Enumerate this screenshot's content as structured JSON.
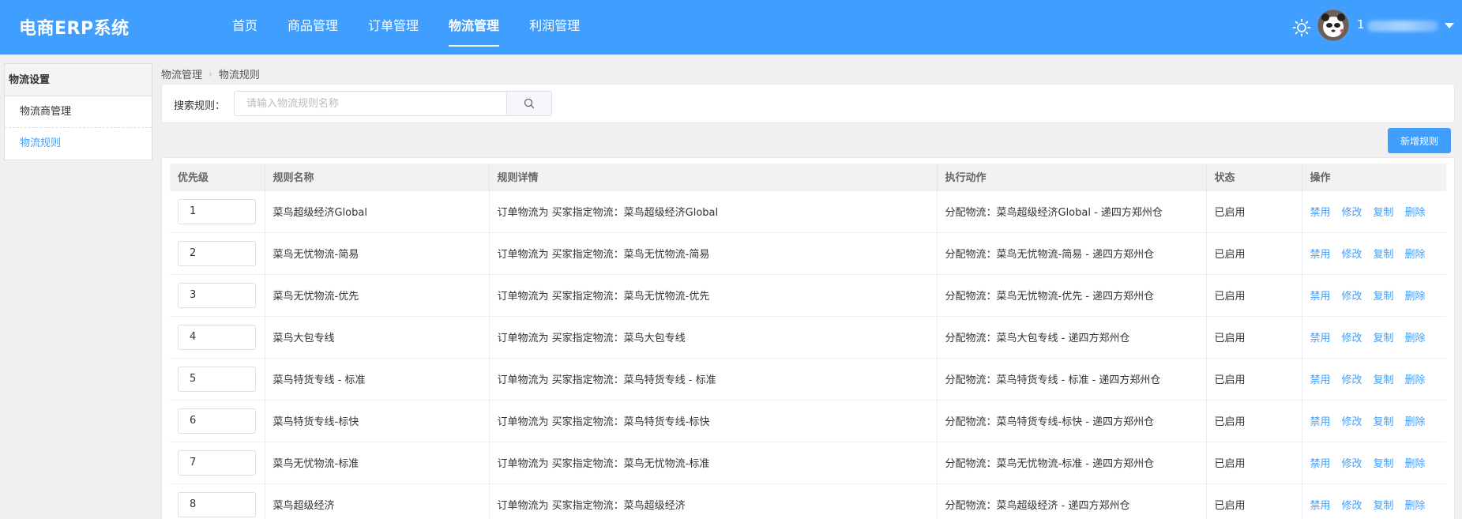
{
  "header": {
    "brand": "电商ERP系统",
    "nav": [
      {
        "label": "首页",
        "active": false
      },
      {
        "label": "商品管理",
        "active": false
      },
      {
        "label": "订单管理",
        "active": false
      },
      {
        "label": "物流管理",
        "active": true
      },
      {
        "label": "利润管理",
        "active": false
      }
    ],
    "user_initial": "1"
  },
  "sidebar": {
    "title": "物流设置",
    "items": [
      {
        "label": "物流商管理",
        "active": false
      },
      {
        "label": "物流规则",
        "active": true
      }
    ]
  },
  "breadcrumb": [
    "物流管理",
    "物流规则"
  ],
  "search": {
    "label": "搜索规则：",
    "placeholder": "请输入物流规则名称",
    "value": ""
  },
  "add_button": "新增规则",
  "table": {
    "columns": [
      "优先级",
      "规则名称",
      "规则详情",
      "执行动作",
      "状态",
      "操作"
    ],
    "actions": [
      "禁用",
      "修改",
      "复制",
      "删除"
    ],
    "rows": [
      {
        "priority": "1",
        "name": "菜鸟超级经济Global",
        "detail": "订单物流为 买家指定物流：菜鸟超级经济Global",
        "action": "分配物流：菜鸟超级经济Global - 递四方郑州仓",
        "status": "已启用"
      },
      {
        "priority": "2",
        "name": "菜鸟无忧物流-简易",
        "detail": "订单物流为 买家指定物流：菜鸟无忧物流-简易",
        "action": "分配物流：菜鸟无忧物流-简易 - 递四方郑州仓",
        "status": "已启用"
      },
      {
        "priority": "3",
        "name": "菜鸟无忧物流-优先",
        "detail": "订单物流为 买家指定物流：菜鸟无忧物流-优先",
        "action": "分配物流：菜鸟无忧物流-优先 - 递四方郑州仓",
        "status": "已启用"
      },
      {
        "priority": "4",
        "name": "菜鸟大包专线",
        "detail": "订单物流为 买家指定物流：菜鸟大包专线",
        "action": "分配物流：菜鸟大包专线 - 递四方郑州仓",
        "status": "已启用"
      },
      {
        "priority": "5",
        "name": "菜鸟特货专线 - 标准",
        "detail": "订单物流为 买家指定物流：菜鸟特货专线 - 标准",
        "action": "分配物流：菜鸟特货专线 - 标准 - 递四方郑州仓",
        "status": "已启用"
      },
      {
        "priority": "6",
        "name": "菜鸟特货专线-标快",
        "detail": "订单物流为 买家指定物流：菜鸟特货专线-标快",
        "action": "分配物流：菜鸟特货专线-标快 - 递四方郑州仓",
        "status": "已启用"
      },
      {
        "priority": "7",
        "name": "菜鸟无忧物流-标准",
        "detail": "订单物流为 买家指定物流：菜鸟无忧物流-标准",
        "action": "分配物流：菜鸟无忧物流-标准 - 递四方郑州仓",
        "status": "已启用"
      },
      {
        "priority": "8",
        "name": "菜鸟超级经济",
        "detail": "订单物流为 买家指定物流：菜鸟超级经济",
        "action": "分配物流：菜鸟超级经济 - 递四方郑州仓",
        "status": "已启用"
      }
    ]
  },
  "colors": {
    "primary": "#409eff",
    "background": "#f0f0f0"
  }
}
